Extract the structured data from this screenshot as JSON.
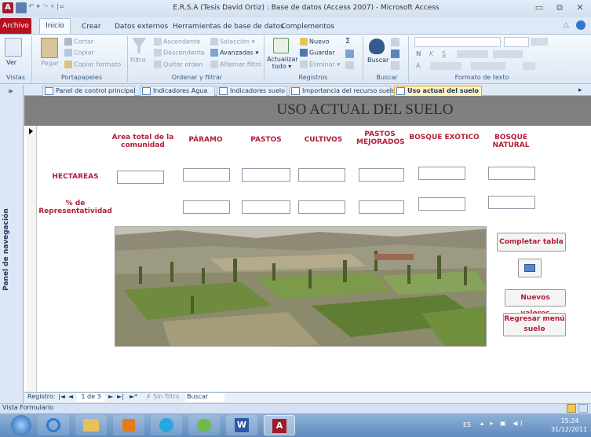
{
  "window": {
    "title": "E.R.S.A (Tesis David Ortiz) : Base de datos (Access 2007) - Microsoft Access",
    "app_icon": "A",
    "qat_separator": "|="
  },
  "ribbon_tabs": [
    "Archivo",
    "Inicio",
    "Crear",
    "Datos externos",
    "Herramientas de base de datos",
    "Complementos"
  ],
  "ribbon": {
    "vistas": {
      "ver": "Ver",
      "label": "Vistas"
    },
    "portapapeles": {
      "pegar": "Pegar",
      "cortar": "Cortar",
      "copiar": "Copiar",
      "copiar_formato": "Copiar formato",
      "label": "Portapapeles"
    },
    "ordenar": {
      "filtro": "Filtro",
      "ascendente": "Ascendente",
      "descendente": "Descendente",
      "quitar_orden": "Quitar orden",
      "seleccion": "Selección",
      "avanzadas": "Avanzadas",
      "alternar_filtro": "Alternar filtro",
      "label": "Ordenar y filtrar"
    },
    "registros": {
      "actualizar": "Actualizar",
      "todo": "todo",
      "nuevo": "Nuevo",
      "guardar": "Guardar",
      "eliminar": "Eliminar",
      "sigma": "Σ",
      "label": "Registros"
    },
    "buscar": {
      "buscar": "Buscar",
      "label": "Buscar"
    },
    "formato": {
      "bold": "N",
      "italic": "K",
      "underline": "S",
      "font_a": "A",
      "label": "Formato de texto"
    }
  },
  "nav_pane": {
    "label": "Panel de navegación",
    "toggle": "»"
  },
  "doc_tabs": [
    {
      "label": "Panel de control principal",
      "active": false
    },
    {
      "label": "Indicadores Agua",
      "active": false
    },
    {
      "label": "Indicadores suelo",
      "active": false
    },
    {
      "label": "Importancia del recurso suelo",
      "active": false
    },
    {
      "label": "Uso actual del suelo",
      "active": true
    }
  ],
  "form": {
    "title": "USO ACTUAL DEL SUELO",
    "columns": [
      "Area total de la comunidad",
      "PÁRAMO",
      "PASTOS",
      "CULTIVOS",
      "PASTOS MEJORADOS",
      "BOSQUE EXÓTICO",
      "BOSQUE NATURAL"
    ],
    "rows": [
      "HECTAREAS",
      "% de Representatividad"
    ],
    "buttons": {
      "completar": "Completar tabla",
      "nuevos": "Nuevos valores",
      "regresar": "Regresar menú suelo"
    }
  },
  "record_nav": {
    "prefix": "Registro:",
    "first": "|◄",
    "prev": "◄",
    "position": "1 de 3",
    "next": "►",
    "last": "►|",
    "new": "►*",
    "filter": "Sin filtro",
    "search": "Buscar"
  },
  "status": {
    "left": "Vista Formulario"
  },
  "taskbar": {
    "lang": "ES",
    "time": "15:24",
    "date": "31/12/2011"
  },
  "colors": {
    "accent_red": "#b0203a",
    "archivo_tab": "#b3121f",
    "header_gray": "#7f7f7f",
    "active_tab": "#fff3c4"
  }
}
